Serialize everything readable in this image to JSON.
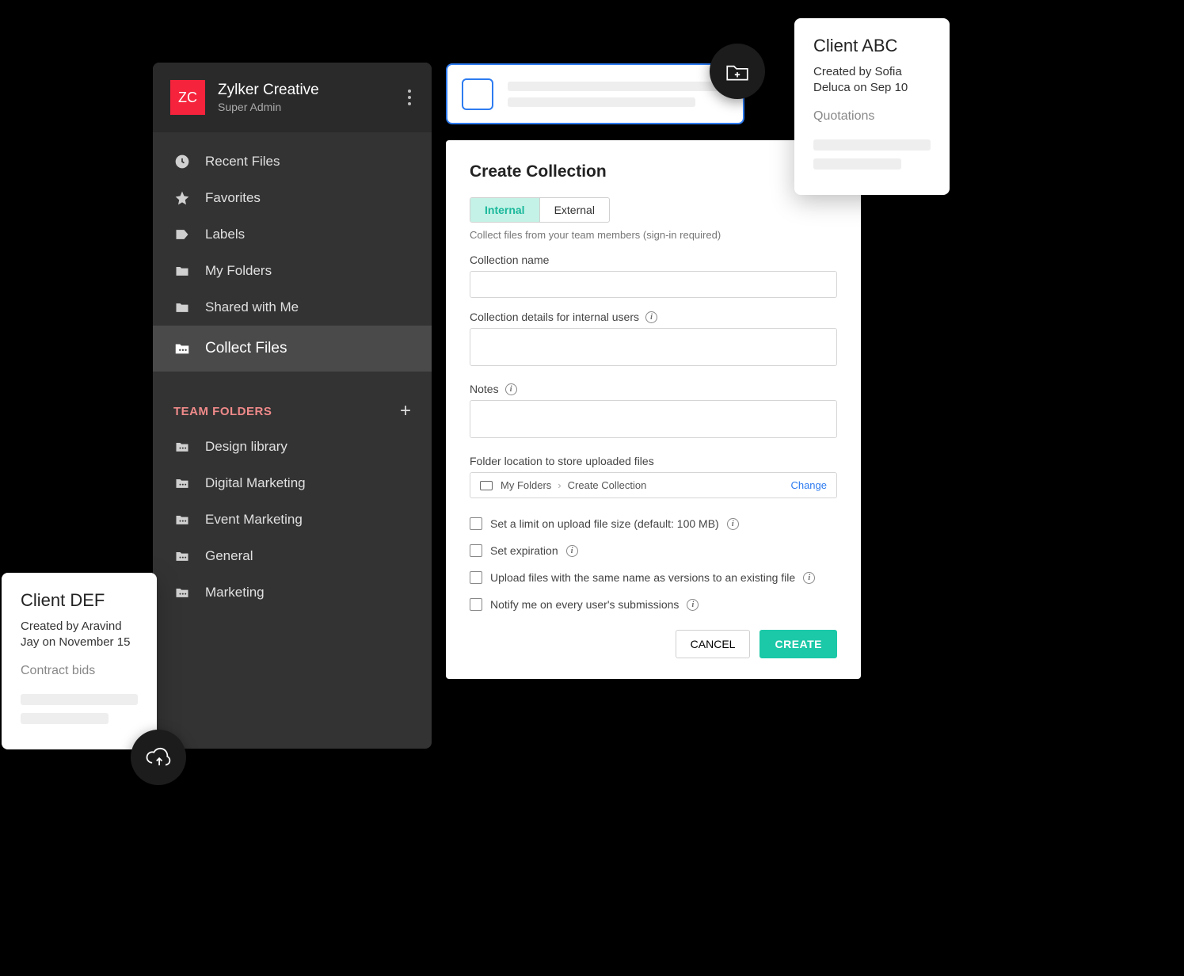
{
  "sidebar": {
    "org_avatar": "ZC",
    "org_name": "Zylker Creative",
    "org_role": "Super Admin",
    "nav": [
      {
        "label": "Recent Files",
        "icon": "clock"
      },
      {
        "label": "Favorites",
        "icon": "star"
      },
      {
        "label": "Labels",
        "icon": "tag"
      },
      {
        "label": "My Folders",
        "icon": "folder"
      },
      {
        "label": "Shared with Me",
        "icon": "folder"
      },
      {
        "label": "Collect Files",
        "icon": "folder-files",
        "active": true
      }
    ],
    "team_section_title": "TEAM FOLDERS",
    "team": [
      {
        "label": "Design library"
      },
      {
        "label": "Digital Marketing"
      },
      {
        "label": "Event Marketing"
      },
      {
        "label": "General"
      },
      {
        "label": "Marketing"
      }
    ]
  },
  "modal": {
    "title": "Create Collection",
    "tabs": {
      "internal": "Internal",
      "external": "External"
    },
    "tab_desc": "Collect files from your team members (sign-in required)",
    "fields": {
      "name_label": "Collection name",
      "details_label": "Collection details for internal users",
      "notes_label": "Notes",
      "location_label": "Folder location to store uploaded files"
    },
    "breadcrumb": {
      "root": "My Folders",
      "leaf": "Create Collection",
      "change": "Change"
    },
    "checks": {
      "size": "Set a limit on upload file size (default: 100 MB)",
      "expire": "Set expiration",
      "versions": "Upload files with the same name as versions to an existing file",
      "notify": "Notify me on every user's submissions"
    },
    "actions": {
      "cancel": "CANCEL",
      "create": "CREATE"
    }
  },
  "cards": {
    "abc": {
      "title": "Client ABC",
      "meta": "Created by Sofia Deluca on Sep 10",
      "sub": "Quotations"
    },
    "def": {
      "title": "Client DEF",
      "meta": "Created by Aravind Jay on November 15",
      "sub": "Contract bids"
    }
  }
}
